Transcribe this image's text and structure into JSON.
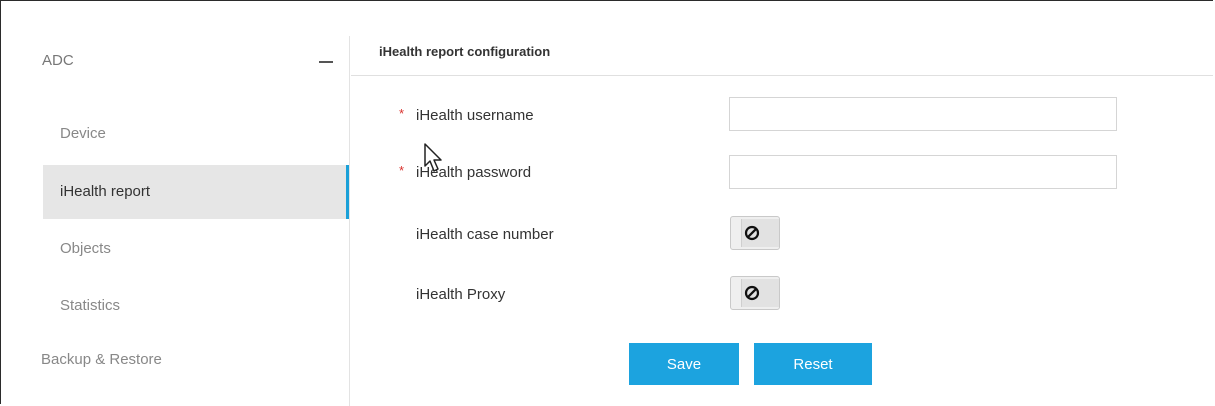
{
  "sidebar": {
    "section_label": "ADC",
    "items": [
      {
        "label": "Device"
      },
      {
        "label": "iHealth report"
      },
      {
        "label": "Objects"
      },
      {
        "label": "Statistics"
      }
    ],
    "backup_label": "Backup & Restore"
  },
  "form": {
    "title": "iHealth report configuration",
    "required_marker": "*",
    "fields": {
      "username": {
        "label": "iHealth username",
        "value": ""
      },
      "password": {
        "label": "iHealth password",
        "value": ""
      },
      "case_number": {
        "label": "iHealth case number",
        "toggle_icon": "disabled-icon"
      },
      "proxy": {
        "label": "iHealth Proxy",
        "toggle_icon": "disabled-icon"
      }
    },
    "buttons": {
      "save": "Save",
      "reset": "Reset"
    }
  },
  "colors": {
    "accent": "#1ca3df",
    "required": "#d9302c",
    "active_bg": "#e6e6e6"
  }
}
